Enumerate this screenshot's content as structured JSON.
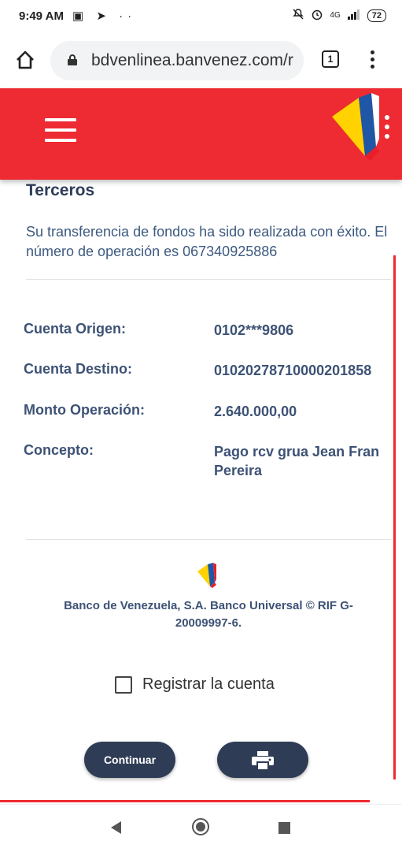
{
  "status_bar": {
    "time": "9:49 AM",
    "left_icons": "▣ ➤ ··",
    "network": "4G",
    "battery": "72"
  },
  "browser": {
    "url": "bdvenlinea.banvenez.com/r",
    "tab_count": "1"
  },
  "page": {
    "heading": "Terceros",
    "message": "Su transferencia de fondos ha sido realizada con éxito. El número de operación es 067340925886",
    "details": [
      {
        "label": "Cuenta Origen:",
        "value": "0102***9806"
      },
      {
        "label": "Cuenta Destino:",
        "value": "01020278710000201858"
      },
      {
        "label": "Monto Operación:",
        "value": "2.640.000,00"
      },
      {
        "label": "Concepto:",
        "value": "Pago rcv grua Jean Fran",
        "value_line2": "Pereira"
      }
    ],
    "footer_text": "Banco de Venezuela, S.A. Banco Universal © RIF G-20009997-6.",
    "register_label": "Registrar la cuenta",
    "continue_label": "Continuar"
  },
  "colors": {
    "brand_red": "#ee2a32",
    "button_navy": "#2f3c55",
    "text_blue": "#3d5275"
  }
}
